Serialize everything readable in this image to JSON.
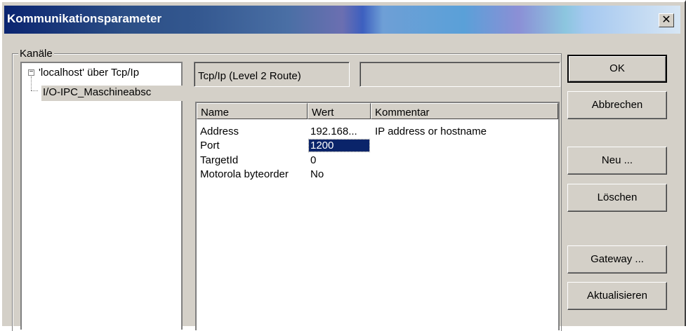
{
  "window": {
    "title": "Kommunikationsparameter",
    "close_glyph": "✕",
    "colors": {
      "title_start": "#0a2470",
      "face": "#d4d0c8",
      "selection": "#0a246a"
    }
  },
  "group": {
    "label": "Kanäle"
  },
  "tree": {
    "expander_glyph": "−",
    "root": "'localhost' über Tcp/Ip",
    "child": "I/O-IPC_Maschineabsc"
  },
  "driver": {
    "name": "Tcp/Ip (Level 2 Route)",
    "info": ""
  },
  "params": {
    "columns": {
      "name": "Name",
      "value": "Wert",
      "comment": "Kommentar"
    },
    "rows": [
      {
        "name": "Address",
        "value": "192.168...",
        "comment": "IP address or hostname"
      },
      {
        "name": "Port",
        "value": "1200",
        "comment": ""
      },
      {
        "name": "TargetId",
        "value": "0",
        "comment": ""
      },
      {
        "name": "Motorola byteorder",
        "value": "No",
        "comment": ""
      }
    ]
  },
  "buttons": {
    "ok": "OK",
    "cancel": "Abbrechen",
    "new": "Neu ...",
    "delete": "Löschen",
    "gateway": "Gateway ...",
    "refresh": "Aktualisieren"
  }
}
